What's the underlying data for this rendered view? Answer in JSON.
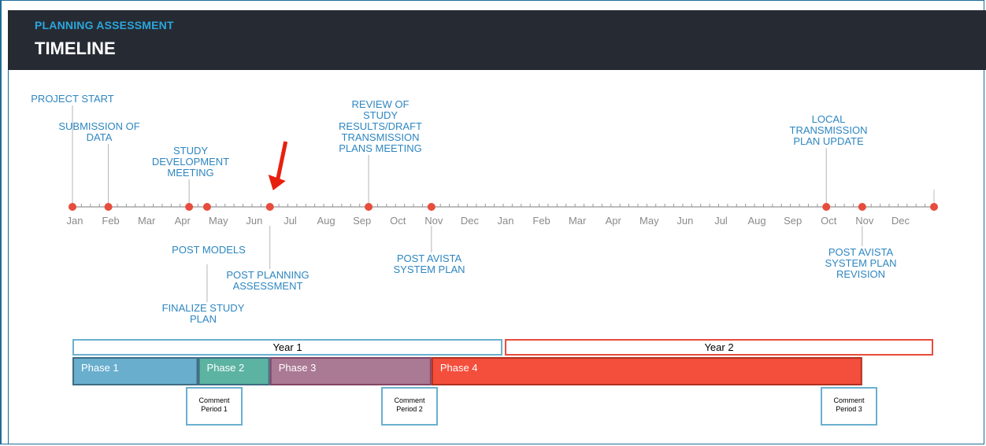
{
  "header": {
    "kicker": "PLANNING ASSESSMENT",
    "title": "TIMELINE"
  },
  "axis": {
    "months": [
      "Jan",
      "Feb",
      "Mar",
      "Apr",
      "May",
      "Jun",
      "Jul",
      "Aug",
      "Sep",
      "Oct",
      "Nov",
      "Dec",
      "Jan",
      "Feb",
      "Mar",
      "Apr",
      "May",
      "Jun",
      "Jul",
      "Aug",
      "Sep",
      "Oct",
      "Nov",
      "Dec"
    ]
  },
  "milestones_above": [
    {
      "month": 0.0,
      "lines": [
        "PROJECT START"
      ]
    },
    {
      "month": 1.0,
      "lines": [
        "SUBMISSION  OF",
        "DATA"
      ]
    },
    {
      "month": 3.25,
      "lines": [
        "STUDY",
        "DEVELOPMENT",
        "MEETING"
      ]
    },
    {
      "month": 8.25,
      "lines": [
        "REVIEW OF",
        "STUDY",
        "RESULTS/DRAFT",
        "TRANSMISSION",
        "PLANS MEETING"
      ]
    },
    {
      "month": 21.0,
      "lines": [
        "LOCAL",
        "TRANSMISSION",
        "PLAN UPDATE"
      ]
    }
  ],
  "milestones_below": [
    {
      "month": 3.75,
      "lines": [
        "POST MODELS"
      ]
    },
    {
      "month": 3.75,
      "lines": [
        "FINALIZE  STUDY",
        "PLAN"
      ]
    },
    {
      "month": 5.5,
      "lines": [
        "POST PLANNING",
        "ASSESSMENT"
      ]
    },
    {
      "month": 10.0,
      "lines": [
        "POST AVISTA",
        "SYSTEM  PLAN"
      ]
    },
    {
      "month": 22.0,
      "lines": [
        "POST AVISTA",
        "SYSTEM  PLAN",
        "REVISION"
      ]
    }
  ],
  "markers": [
    0,
    1,
    3.25,
    3.75,
    5.5,
    8.25,
    10.0,
    21.0,
    22.0,
    24.0
  ],
  "current_marker_month": 5.5,
  "years": [
    {
      "label": "Year 1",
      "start": 0,
      "end": 12,
      "color": "#6bb0cf"
    },
    {
      "label": "Year 2",
      "start": 12,
      "end": 24,
      "color": "#e74c3c"
    }
  ],
  "phases": [
    {
      "label": "Phase 1",
      "start": 0,
      "end": 3.5,
      "fill": "#6aaecd",
      "stroke": "#3f6c83"
    },
    {
      "label": "Phase 2",
      "start": 3.5,
      "end": 5.5,
      "fill": "#5cb3a2",
      "stroke": "#3f6c83"
    },
    {
      "label": "Phase 3",
      "start": 5.5,
      "end": 10.0,
      "fill": "#aa7994",
      "stroke": "#844566"
    },
    {
      "label": "Phase 4",
      "start": 10.0,
      "end": 22.0,
      "fill": "#f44e3c",
      "stroke": "#b0321f"
    }
  ],
  "comments": [
    {
      "lines": [
        "Comment",
        "Period 1"
      ],
      "month": 3.9
    },
    {
      "lines": [
        "Comment",
        "Period 2"
      ],
      "month": 9.3
    },
    {
      "lines": [
        "Comment",
        "Period 3"
      ],
      "month": 21.6
    }
  ],
  "colors": {
    "marker": "#e74c3c",
    "arrow": "#e8200f",
    "axis": "#bdbdbd",
    "label": "#2e86c1"
  }
}
